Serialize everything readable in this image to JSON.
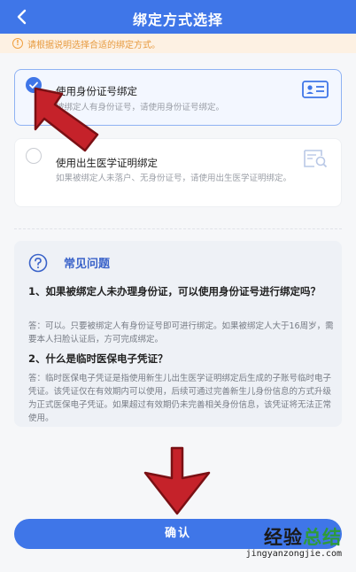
{
  "header": {
    "title": "绑定方式选择",
    "back_icon": "chevron-left-icon"
  },
  "notice": {
    "text": "请根据说明选择合适的绑定方式。",
    "icon": "exclamation-circle-icon",
    "color": "#e79a3f"
  },
  "options": [
    {
      "title": "使用身份证号绑定",
      "description": "被绑定人有身份证号，请使用身份证号绑定。",
      "selected": true,
      "icon": "id-card-icon"
    },
    {
      "title": "使用出生医学证明绑定",
      "description": "如果被绑定人未落户、无身份证号，请使用出生医学证明绑定。",
      "selected": false,
      "icon": "certificate-search-icon"
    }
  ],
  "faq": {
    "title": "常见问题",
    "icon": "question-circle-icon",
    "items": [
      {
        "question": "1、如果被绑定人未办理身份证，可以使用身份证号进行绑定吗？",
        "answer": "答：可以。只要被绑定人有身份证号即可进行绑定。如果被绑定人大于16周岁，需要本人扫脸认证后，方可完成绑定。"
      },
      {
        "question": "2、什么是临时医保电子凭证？",
        "answer": "答：临时医保电子凭证是指使用新生儿出生医学证明绑定后生成的子账号临时电子凭证。该凭证仅在有效期内可以使用，后续可通过完善新生儿身份信息的方式升级为正式医保电子凭证。如果超过有效期仍未完善相关身份信息，该凭证将无法正常使用。"
      }
    ]
  },
  "confirm": {
    "label": "确认"
  },
  "watermark": {
    "text_part1": "经验",
    "text_part2": "总结",
    "url": "jingyanzongjie.com"
  },
  "colors": {
    "primary": "#3f76e8",
    "arrow": "#c5222a",
    "faq_title": "#3a63c9"
  }
}
